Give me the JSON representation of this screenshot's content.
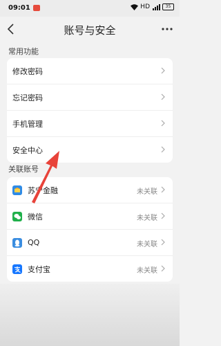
{
  "status_bar": {
    "time": "09:01",
    "network": "HD",
    "battery": "35"
  },
  "nav": {
    "title": "账号与安全"
  },
  "common": {
    "label": "常用功能",
    "items": [
      {
        "label": "修改密码"
      },
      {
        "label": "忘记密码"
      },
      {
        "label": "手机管理"
      },
      {
        "label": "安全中心"
      }
    ]
  },
  "linked": {
    "label": "关联账号",
    "items": [
      {
        "label": "苏宁金融",
        "status": "未关联",
        "icon": "suning-finance-icon"
      },
      {
        "label": "微信",
        "status": "未关联",
        "icon": "wechat-icon"
      },
      {
        "label": "QQ",
        "status": "未关联",
        "icon": "qq-icon"
      },
      {
        "label": "支付宝",
        "status": "未关联",
        "icon": "alipay-icon"
      }
    ]
  },
  "colors": {
    "annotation_arrow": "#e8433a",
    "suning": "#2f8be6",
    "wechat": "#20b04b",
    "qq": "#3a8de0",
    "alipay": "#1677ff"
  }
}
